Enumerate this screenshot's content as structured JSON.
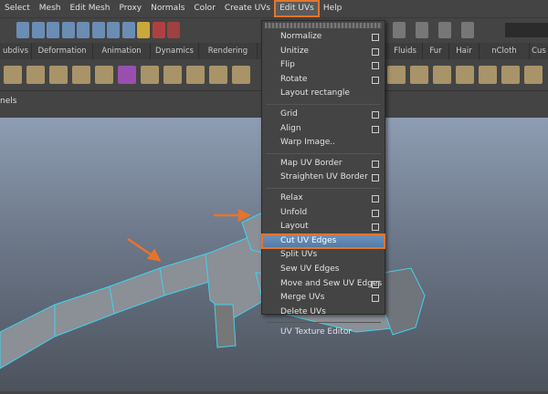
{
  "menubar": {
    "items": [
      "Select",
      "Mesh",
      "Edit Mesh",
      "Proxy",
      "Normals",
      "Color",
      "Create UVs",
      "Edit UVs",
      "Help"
    ],
    "active": "Edit UVs"
  },
  "shelf_tabs": [
    "ubdivs",
    "Deformation",
    "Animation",
    "Dynamics",
    "Rendering",
    "F",
    "Fluids",
    "Fur",
    "Hair",
    "nCloth",
    "Cus"
  ],
  "panels_label": "nels",
  "edit_uvs_menu": {
    "groups": [
      [
        {
          "label": "Normalize",
          "option": true
        },
        {
          "label": "Unitize",
          "option": true
        },
        {
          "label": "Flip",
          "option": true
        },
        {
          "label": "Rotate",
          "option": true
        },
        {
          "label": "Layout rectangle",
          "option": false
        }
      ],
      [
        {
          "label": "Grid",
          "option": true
        },
        {
          "label": "Align",
          "option": true
        },
        {
          "label": "Warp Image..",
          "option": false
        }
      ],
      [
        {
          "label": "Map UV Border",
          "option": true
        },
        {
          "label": "Straighten UV Border",
          "option": true
        }
      ],
      [
        {
          "label": "Relax",
          "option": true
        },
        {
          "label": "Unfold",
          "option": true
        },
        {
          "label": "Layout",
          "option": true
        },
        {
          "label": "Cut UV Edges",
          "option": false,
          "highlighted": true
        },
        {
          "label": "Split UVs",
          "option": false
        },
        {
          "label": "Sew UV Edges",
          "option": false
        },
        {
          "label": "Move and Sew UV Edges",
          "option": true
        },
        {
          "label": "Merge UVs",
          "option": true
        },
        {
          "label": "Delete UVs",
          "option": false
        }
      ],
      [
        {
          "label": "UV Texture Editor",
          "option": false
        }
      ]
    ]
  },
  "colors": {
    "highlight": "#e8742c",
    "selection": "#5f86b2",
    "wireframe": "#3fd3ee"
  }
}
